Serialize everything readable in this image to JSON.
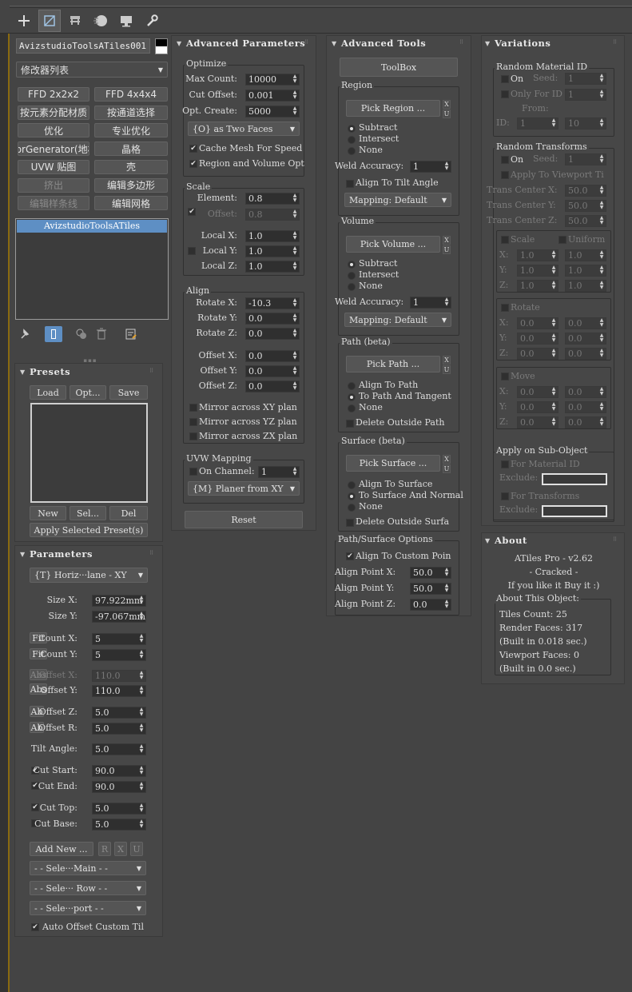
{
  "toolbar": {
    "tabs": [
      "create",
      "modify",
      "hierarchy",
      "motion",
      "display",
      "utilities"
    ]
  },
  "left": {
    "object_name": "AvizstudioToolsATiles001",
    "modifier_list": "修改器列表",
    "buttons": [
      [
        "FFD 2x2x2",
        "FFD 4x4x4"
      ],
      [
        "按元素分配材质",
        "按通道选择"
      ],
      [
        "优化",
        "专业优化"
      ],
      [
        "oorGenerator(地板",
        "晶格"
      ],
      [
        "UVW 贴图",
        "壳"
      ],
      [
        "挤出",
        "编辑多边形"
      ],
      [
        "编辑样条线",
        "编辑网格"
      ]
    ],
    "stack_item": "AvizstudioToolsATiles",
    "presets": {
      "title": "Presets",
      "load": "Load",
      "opt": "Opt...",
      "save": "Save",
      "new": "New",
      "sel": "Sel...",
      "del": "Del",
      "apply": "Apply Selected Preset(s)"
    },
    "parameters": {
      "title": "Parameters",
      "plane": "{T} Horiz···lane - XY",
      "size_x_label": "Size X:",
      "size_x": "97.922mm",
      "size_y_label": "Size Y:",
      "size_y": "-97.067mm",
      "fit": "Fit",
      "count_x_label": "Count X:",
      "count_x": "5",
      "count_y_label": "Count Y:",
      "count_y": "5",
      "abs": "Abs",
      "offset_x_label": "Offset X:",
      "offset_x": "110.0",
      "offset_y_label": "Offset Y:",
      "offset_y": "110.0",
      "ab": "Ab",
      "offset_z_label": "Offset Z:",
      "offset_z": "5.0",
      "offset_r_label": "Offset R:",
      "offset_r": "5.0",
      "tilt_label": "Tilt Angle:",
      "tilt": "5.0",
      "cut_start_label": "Cut Start:",
      "cut_start": "90.0",
      "cut_end_label": "Cut End:",
      "cut_end": "90.0",
      "cut_top_label": "Cut Top:",
      "cut_top": "5.0",
      "cut_base_label": "Cut Base:",
      "cut_base": "5.0",
      "add_new": "Add New ...",
      "r": "R",
      "x": "X",
      "u": "U",
      "sel_main": "- - Sele···Main - -",
      "sel_row": "- - Sele··· Row - -",
      "sel_port": "- - Sele···port - -",
      "auto_offset": "Auto Offset Custom Til"
    }
  },
  "adv": {
    "title": "Advanced Parameters",
    "optimize": "Optimize",
    "max_count_label": "Max Count:",
    "max_count": "10000",
    "cut_offset_label": "Cut Offset:",
    "cut_offset": "0.001",
    "opt_create_label": "Opt. Create:",
    "opt_create": "5000",
    "faces": "{O} as Two Faces",
    "cache": "Cache Mesh For Speed",
    "region_vol": "Region and Volume Opt",
    "scale": "Scale",
    "element_label": "Element:",
    "element": "0.8",
    "offset_label": "Offset:",
    "offset": "0.8",
    "lx_label": "Local X:",
    "lx": "1.0",
    "ly_label": "Local Y:",
    "ly": "1.0",
    "lz_label": "Local Z:",
    "lz": "1.0",
    "align": "Align",
    "rx_label": "Rotate X:",
    "rx": "-10.3",
    "ry_label": "Rotate Y:",
    "ry": "0.0",
    "rz_label": "Rotate Z:",
    "rz": "0.0",
    "ox_label": "Offset X:",
    "ox": "0.0",
    "oy_label": "Offset Y:",
    "oy": "0.0",
    "oz_label": "Offset Z:",
    "oz": "0.0",
    "mxy": "Mirror across XY plan",
    "myz": "Mirror across YZ plan",
    "mzx": "Mirror across ZX plan",
    "uvw": "UVW Mapping",
    "on_channel": "On Channel:",
    "channel": "1",
    "planer": "{M} Planer from XY",
    "reset": "Reset"
  },
  "tools": {
    "title": "Advanced Tools",
    "toolbox": "ToolBox",
    "region": "Region",
    "pick_region": "Pick Region ...",
    "subtract": "Subtract",
    "intersect": "Intersect",
    "none": "None",
    "weld": "Weld Accuracy:",
    "weld_val": "1",
    "align_tilt": "Align To Tilt Angle",
    "mapping": "Mapping: Default",
    "volume": "Volume",
    "pick_volume": "Pick Volume ...",
    "weld_val2": "1",
    "path": "Path (beta)",
    "pick_path": "Pick Path ...",
    "align_path": "Align To Path",
    "path_tangent": "To Path And Tangent",
    "delete_path": "Delete Outside Path",
    "surface": "Surface (beta)",
    "pick_surface": "Pick Surface ...",
    "align_surface": "Align To Surface",
    "surface_normal": "To Surface And Normal",
    "delete_surface": "Delete Outside Surfa",
    "ps_options": "Path/Surface Options",
    "custom_point": "Align To Custom Poin",
    "apx_label": "Align Point X:",
    "apx": "50.0",
    "apy_label": "Align Point Y:",
    "apy": "50.0",
    "apz_label": "Align Point Z:",
    "apz": "0.0",
    "x": "X",
    "u": "U"
  },
  "var": {
    "title": "Variations",
    "rmid": "Random Material ID",
    "on": "On",
    "seed": "Seed:",
    "seed_val": "1",
    "only_id": "Only For ID",
    "only_val": "1",
    "from": "From:",
    "id_label": "ID:",
    "id_from": "1",
    "id_to": "10",
    "rtrans": "Random Transforms",
    "seed_val2": "1",
    "apply_vp": "Apply To Viewport Ti",
    "tcx": "Trans Center X:",
    "tcx_v": "50.0",
    "tcy": "Trans Center Y:",
    "tcy_v": "50.0",
    "tcz": "Trans Center Z:",
    "tcz_v": "50.0",
    "scale": "Scale",
    "uniform": "Uniform",
    "x": "X:",
    "y": "Y:",
    "z": "Z:",
    "one": "1.0",
    "zero": "0.0",
    "rotate": "Rotate",
    "move": "Move",
    "sub_obj": "Apply on Sub-Object",
    "for_mat": "For Material ID",
    "exclude": "Exclude:",
    "for_trans": "For Transforms"
  },
  "about": {
    "title": "About",
    "version": "ATiles Pro - v2.62",
    "cracked": "- Cracked -",
    "buy": "If you like it Buy it :)",
    "about_obj": "About This Object:",
    "tiles": "Tiles Count: 25",
    "render": "Render Faces: 317",
    "built1": "(Built in 0.018 sec.)",
    "viewport": "Viewport Faces: 0",
    "built2": "(Built in 0.0 sec.)"
  }
}
